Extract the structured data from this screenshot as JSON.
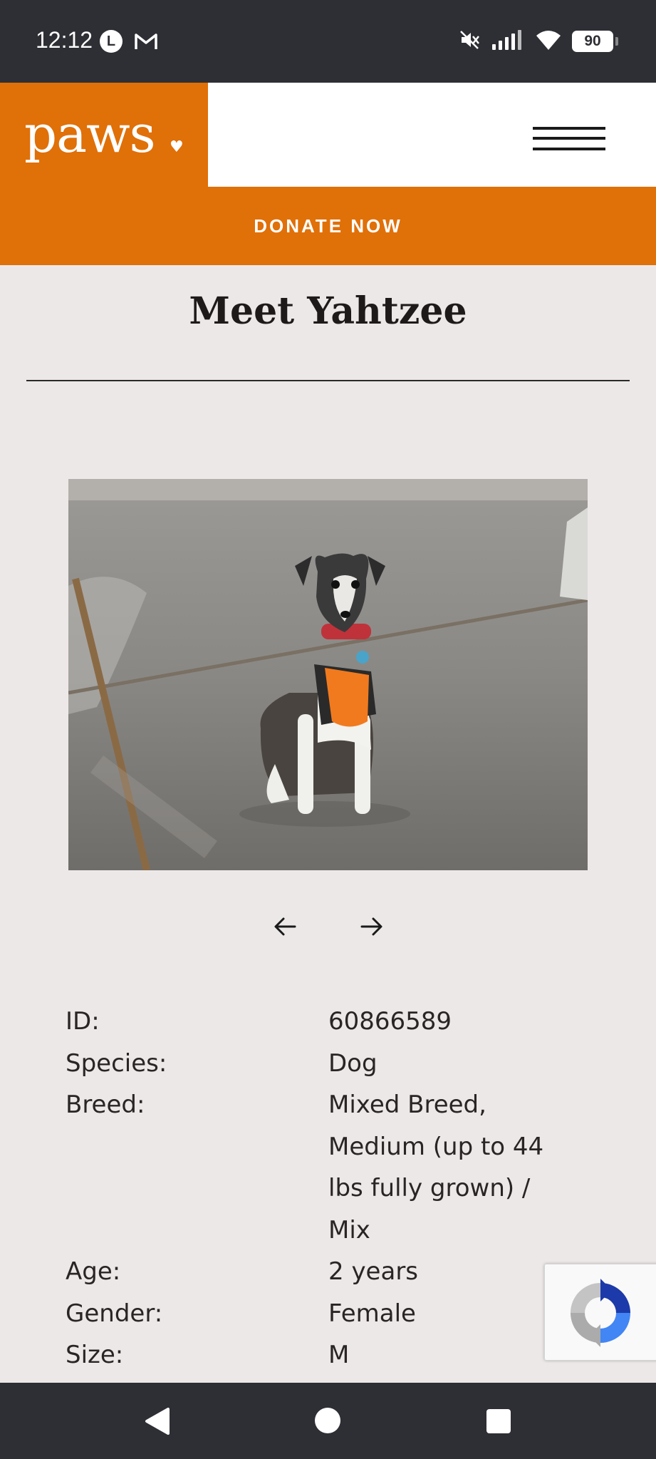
{
  "status_bar": {
    "time": "12:12",
    "notification_icon_letter": "L",
    "battery": "90",
    "icons": [
      "l-app-icon",
      "gmail-icon",
      "mute-icon",
      "signal-icon",
      "wifi-icon",
      "battery-icon"
    ]
  },
  "header": {
    "logo": "paws",
    "brand_color": "#e07008",
    "menu_icon": "hamburger-menu-icon"
  },
  "donate_label": "DONATE NOW",
  "page_title": "Meet Yahtzee",
  "gallery": {
    "photo": "dog-photo",
    "prev_icon": "arrow-left-icon",
    "next_icon": "arrow-right-icon"
  },
  "details": [
    {
      "label": "ID:",
      "value": "60866589"
    },
    {
      "label": "Species:",
      "value": "Dog"
    },
    {
      "label": "Breed:",
      "value": "Mixed Breed, Medium (up to 44 lbs fully grown) / Mix"
    },
    {
      "label": "Age:",
      "value": "2 years"
    },
    {
      "label": "Gender:",
      "value": "Female"
    },
    {
      "label": "Size:",
      "value": "M"
    }
  ],
  "recaptcha_icon": "recaptcha-icon",
  "nav_bar": [
    "back-icon",
    "home-icon",
    "recents-icon"
  ]
}
